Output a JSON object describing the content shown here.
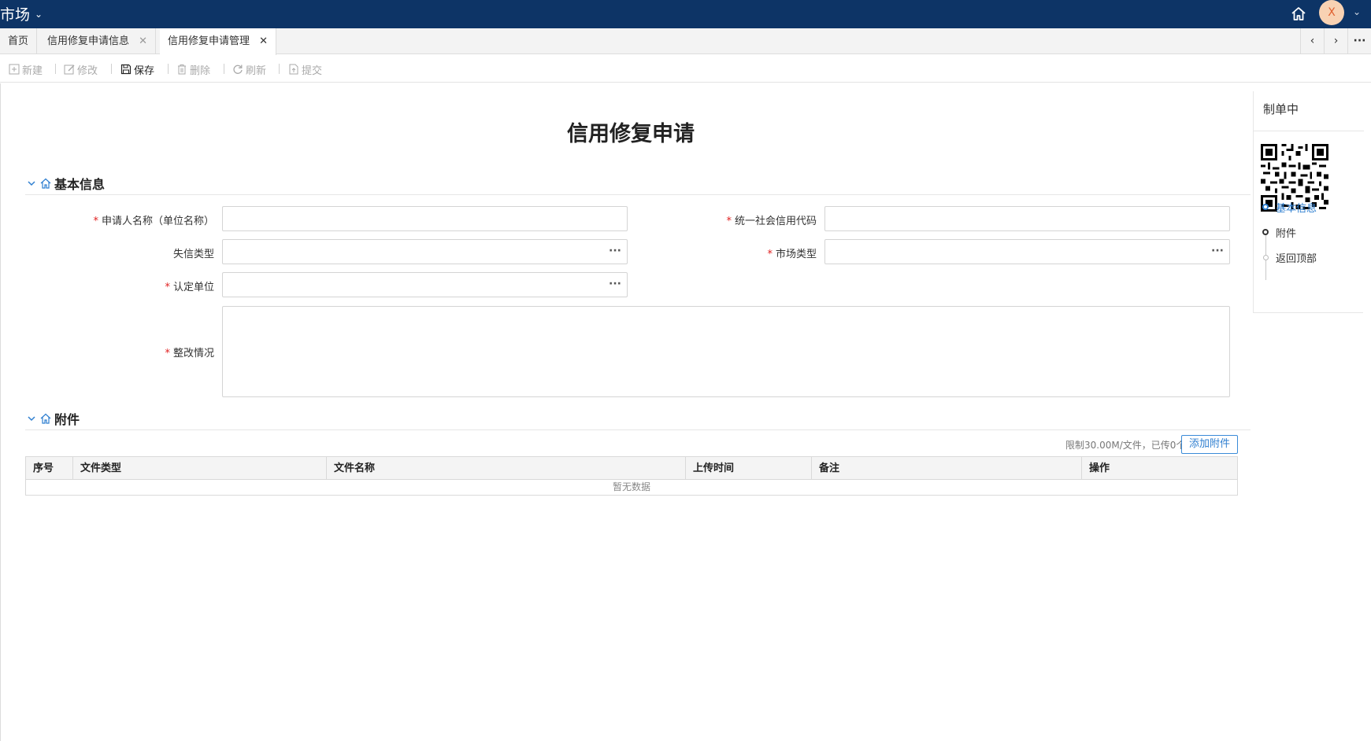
{
  "app": {
    "title": "市场",
    "avatar_letter": "X"
  },
  "tabs": [
    {
      "label": "首页",
      "closable": false
    },
    {
      "label": "信用修复申请信息",
      "closable": true
    },
    {
      "label": "信用修复申请管理",
      "closable": true,
      "active": true
    }
  ],
  "toolbar": {
    "new_label": "新建",
    "edit_label": "修改",
    "save_label": "保存",
    "delete_label": "删除",
    "refresh_label": "刷新",
    "submit_label": "提交"
  },
  "form": {
    "page_title": "信用修复申请",
    "section_basic": "基本信息",
    "applicant_name_label": "申请人名称（单位名称）",
    "credit_code_label": "统一社会信用代码",
    "dishonesty_type_label": "失信类型",
    "market_type_label": "市场类型",
    "certifying_unit_label": "认定单位",
    "rectification_label": "整改情况",
    "applicant_name_value": "",
    "credit_code_value": "",
    "dishonesty_type_value": "",
    "market_type_value": "",
    "certifying_unit_value": "",
    "rectification_value": ""
  },
  "attachments": {
    "section_title": "附件",
    "limit_note": "限制30.00M/文件，已传0个",
    "add_button": "添加附件",
    "columns": [
      "序号",
      "文件类型",
      "文件名称",
      "上传时间",
      "备注",
      "操作"
    ],
    "empty_text": "暂无数据",
    "rows": []
  },
  "side_panel": {
    "status": "制单中",
    "anchors": [
      "基本信息",
      "附件",
      "返回顶部"
    ]
  },
  "colors": {
    "topbar": "#0d3466",
    "accent": "#2f7fd0",
    "required": "#e02020"
  }
}
